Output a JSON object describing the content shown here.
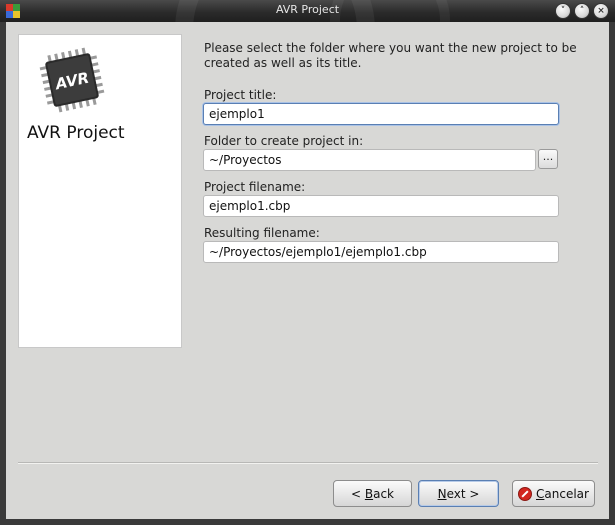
{
  "window": {
    "title": "AVR Project",
    "controls": [
      "minimize",
      "maximize",
      "close"
    ]
  },
  "side_panel": {
    "logo_text": "AVR",
    "title": "AVR Project"
  },
  "intro": "Please select the folder where you want the new project to be created as well as its title.",
  "fields": {
    "project_title": {
      "label": "Project title:",
      "value": "ejemplo1"
    },
    "folder": {
      "label": "Folder to create project in:",
      "value": "~/Proyectos",
      "browse_label": "..."
    },
    "project_filename": {
      "label": "Project filename:",
      "value": "ejemplo1.cbp"
    },
    "resulting_filename": {
      "label": "Resulting filename:",
      "value": "~/Proyectos/ejemplo1/ejemplo1.cbp"
    }
  },
  "buttons": {
    "back": {
      "prefix": "< ",
      "mnemonic": "B",
      "rest": "ack"
    },
    "next": {
      "mnemonic": "N",
      "rest": "ext >"
    },
    "cancel": {
      "mnemonic": "C",
      "rest": "ancelar"
    }
  },
  "colors": {
    "titlebar": "#2b2b2b",
    "background": "#d8d8d6",
    "focus": "#5a7fb3",
    "cancel_icon": "#d3261f"
  }
}
